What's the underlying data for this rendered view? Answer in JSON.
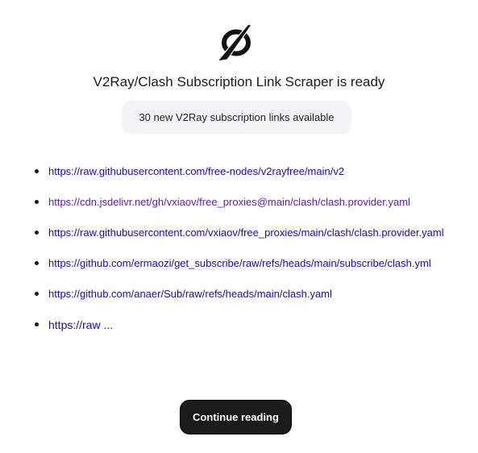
{
  "header": {
    "logo_icon": "slashed-circle-logo-icon",
    "title": "V2Ray/Clash Subscription Link Scraper is ready",
    "subtitle": "30 new V2Ray subscription links available"
  },
  "links": [
    {
      "text": "https://raw.githubusercontent.com/free-nodes/v2rayfree/main/v2",
      "visited": false
    },
    {
      "text": "https://cdn.jsdelivr.net/gh/vxiaov/free_proxies@main/clash/clash.provider.yaml",
      "visited": true
    },
    {
      "text": "https://raw.githubusercontent.com/vxiaov/free_proxies/main/clash/clash.provider.yaml",
      "visited": false
    },
    {
      "text": "https://github.com/ermaozi/get_subscribe/raw/refs/heads/main/subscribe/clash.yml",
      "visited": false
    },
    {
      "text": "https://github.com/anaer/Sub/raw/refs/heads/main/clash.yaml",
      "visited": false
    },
    {
      "text": "https://raw ...",
      "visited": false
    }
  ],
  "actions": {
    "continue_label": "Continue reading"
  },
  "colors": {
    "link": "#1a0dab",
    "link_visited": "#681da8",
    "button_bg": "#1b1b1b",
    "pill_bg": "#f3f4f6"
  }
}
